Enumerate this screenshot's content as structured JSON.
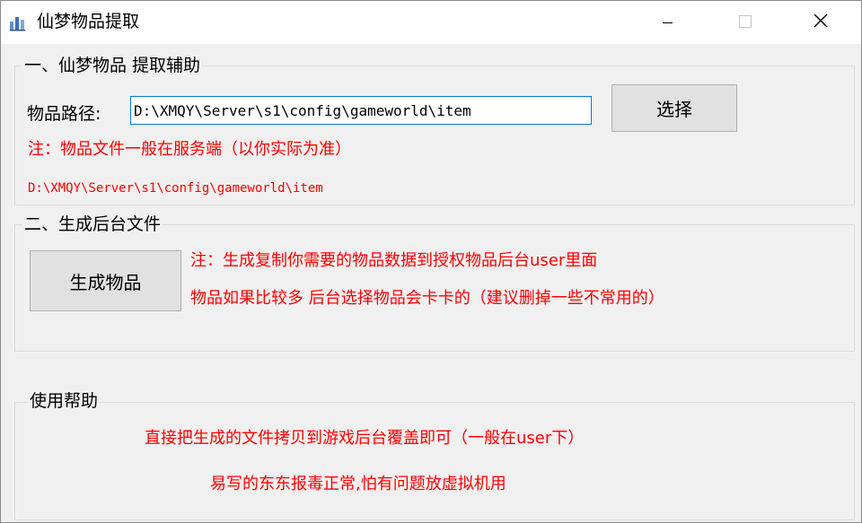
{
  "window": {
    "title": "仙梦物品提取",
    "icon": "app-icon",
    "controls": {
      "minimize": "minimize-icon",
      "maximize": "maximize-icon",
      "close": "close-icon"
    }
  },
  "section1": {
    "legend": "一、仙梦物品 提取辅助",
    "path_label": "物品路径:",
    "path_value": "D:\\XMQY\\Server\\s1\\config\\gameworld\\item",
    "select_button": "选择",
    "note": "注：物品文件一般在服务端（以你实际为准）",
    "path_display": "D:\\XMQY\\Server\\s1\\config\\gameworld\\item"
  },
  "section2": {
    "legend": "二、生成后台文件",
    "generate_button": "生成物品",
    "note1": "注：生成复制你需要的物品数据到授权物品后台user里面",
    "note2": "物品如果比较多 后台选择物品会卡卡的（建议删掉一些不常用的）"
  },
  "section3": {
    "legend": "使用帮助",
    "help1": "直接把生成的文件拷贝到游戏后台覆盖即可（一般在user下）",
    "help2": "易写的东东报毒正常,怕有问题放虚拟机用"
  },
  "colors": {
    "note_text": "#ff0000",
    "input_focus_border": "#0078d7",
    "button_bg": "#e1e1e1",
    "window_bg": "#f0f0f0"
  }
}
